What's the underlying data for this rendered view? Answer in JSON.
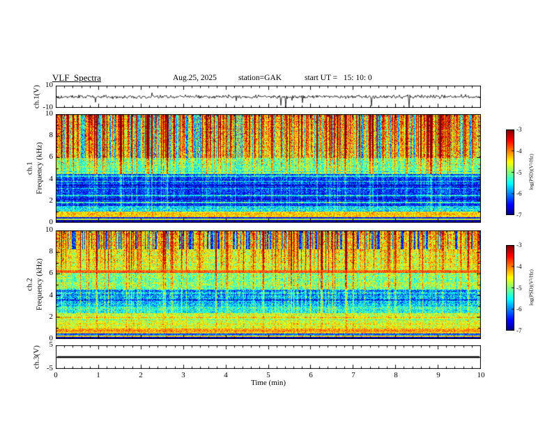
{
  "header": {
    "title": "VLF  Spectra",
    "date": "Aug.25, 2025",
    "station": "station=GAK",
    "start_ut": "start UT =   15: 10: 0"
  },
  "chart_data": {
    "type": "heatmap",
    "title": "VLF Spectra",
    "station": "GAK",
    "date": "Aug.25, 2025",
    "start_ut": "15:10:0",
    "x": {
      "label": "Time  (min)",
      "range": [
        0,
        10
      ],
      "ticks": [
        0,
        1,
        2,
        3,
        4,
        5,
        6,
        7,
        8,
        9,
        10
      ],
      "minor_step": 0.2,
      "unit": "min"
    },
    "panels": [
      {
        "id": "ch1-waveform",
        "type": "line",
        "ylabel": "ch.1(V)",
        "ylim": [
          -10,
          10
        ],
        "yticks": [
          10,
          -10
        ],
        "yminor": [
          0
        ],
        "seed": 101,
        "noise_amp": 1.6,
        "neg_spike_prob": 0.012,
        "neg_spike_range": [
          3,
          10
        ],
        "pos_spike_prob": 0.005,
        "pos_spike_range": [
          2,
          4.5
        ],
        "description": "broadband noise about 0 V with frequent impulsive spikes down to -10 V"
      },
      {
        "id": "ch1-spectrogram",
        "type": "heatmap",
        "ylabel_channel": "ch.1",
        "ylabel_axis": "Frequency (kHz)",
        "ylim": [
          0,
          10
        ],
        "yticks": [
          0,
          2,
          4,
          6,
          8,
          10
        ],
        "yminor": [
          1,
          3,
          5,
          7,
          9
        ],
        "zlim": [
          -7,
          -3
        ],
        "seed": 202,
        "stripe_strong_prob": 0.15,
        "bands": [
          {
            "f": [
              0.0,
              0.28
            ],
            "level": -6.85,
            "noise": 0.15,
            "stripe": 0
          },
          {
            "f": [
              0.28,
              0.4
            ],
            "level": -4.7,
            "noise": 0.35,
            "stripe": 0.05
          },
          {
            "f": [
              0.4,
              0.55
            ],
            "level": -6.4,
            "noise": 0.3,
            "stripe": 0.05
          },
          {
            "f": [
              0.55,
              1.05
            ],
            "level": -4.35,
            "noise": 0.45,
            "stripe": 0.15
          },
          {
            "f": [
              1.05,
              1.55
            ],
            "level": -5.6,
            "noise": 0.6,
            "stripe": 0.25
          },
          {
            "f": [
              1.55,
              4.55
            ],
            "level": -6.45,
            "noise": 0.55,
            "stripe": 0.45
          },
          {
            "f": [
              4.55,
              6.0
            ],
            "level": -5.4,
            "noise": 0.55,
            "stripe": 1.0
          },
          {
            "f": [
              6.0,
              10.01
            ],
            "level": -5.0,
            "noise": 0.6,
            "stripe": 1.4
          }
        ],
        "hlines": [
          {
            "f": 1.9,
            "w": 0.05,
            "d": 0.9
          },
          {
            "f": 2.55,
            "w": 0.05,
            "d": 0.8
          },
          {
            "f": 3.2,
            "w": 0.05,
            "d": 0.7
          },
          {
            "f": 3.85,
            "w": 0.05,
            "d": 0.8
          },
          {
            "f": 4.35,
            "w": 0.06,
            "d": 0.9
          },
          {
            "f": 2.2,
            "w": 0.05,
            "d": -0.4
          },
          {
            "f": 3.5,
            "w": 0.05,
            "d": -0.4
          }
        ],
        "red_top": {
          "fmin": 5.2,
          "gain": 1.2,
          "speckle": 0.05
        },
        "dark_patches": {
          "fmin": 6.0,
          "thresh": 0.18,
          "amount": 1.0
        },
        "description": "impulsive vertical striations above ~5 kHz reaching -3 (red), quiet -6.5 band 1.5-4.5 kHz, bright -4.3 band near 0.6-1 kHz"
      },
      {
        "id": "ch2-spectrogram",
        "type": "heatmap",
        "ylabel_channel": "ch.2",
        "ylabel_axis": "Frequency (kHz)",
        "ylim": [
          0,
          10
        ],
        "yticks": [
          0,
          2,
          4,
          6,
          8,
          10
        ],
        "yminor": [
          1,
          3,
          5,
          7,
          9
        ],
        "zlim": [
          -7,
          -3
        ],
        "seed": 303,
        "stripe_strong_prob": 0.12,
        "bands": [
          {
            "f": [
              0.0,
              0.22
            ],
            "level": -6.85,
            "noise": 0.2,
            "stripe": 0
          },
          {
            "f": [
              0.22,
              0.36
            ],
            "level": -4.5,
            "noise": 0.4,
            "stripe": 0.05
          },
          {
            "f": [
              0.36,
              0.52
            ],
            "level": -6.2,
            "noise": 0.4,
            "stripe": 0.1
          },
          {
            "f": [
              0.52,
              1.0
            ],
            "level": -4.15,
            "noise": 0.4,
            "stripe": 0.1
          },
          {
            "f": [
              1.0,
              2.4
            ],
            "level": -4.8,
            "noise": 0.5,
            "stripe": 0.3
          },
          {
            "f": [
              2.4,
              3.2
            ],
            "level": -5.5,
            "noise": 0.6,
            "stripe": 0.5
          },
          {
            "f": [
              3.2,
              4.6
            ],
            "level": -5.95,
            "noise": 0.65,
            "stripe": 0.75
          },
          {
            "f": [
              4.6,
              6.12
            ],
            "level": -5.25,
            "noise": 0.6,
            "stripe": 0.85
          },
          {
            "f": [
              6.12,
              6.38
            ],
            "level": -3.95,
            "noise": 0.3,
            "stripe": 0.15
          },
          {
            "f": [
              6.38,
              10.01
            ],
            "level": -4.9,
            "noise": 0.6,
            "stripe": 1.0
          }
        ],
        "hlines": [
          {
            "f": 3.6,
            "w": 0.06,
            "d": -0.7
          },
          {
            "f": 4.1,
            "w": 0.05,
            "d": -0.5
          },
          {
            "f": 4.5,
            "w": 0.05,
            "d": -0.5
          },
          {
            "f": 2.0,
            "w": 0.06,
            "d": 0.4
          },
          {
            "f": 1.4,
            "w": 0.05,
            "d": 0.3
          }
        ],
        "red_top": {
          "fmin": 7.0,
          "gain": 0.6,
          "speckle": 0.02
        },
        "dark_patches": {
          "fmin": 8.3,
          "thresh": 0.22,
          "amount": 1.6
        },
        "description": "greenish -4.8 background with vertical striations, bright yellow line at ~6.25 kHz, bright -4.1 band 0.5-1 kHz, dark columns near top"
      },
      {
        "id": "ch3-waveform",
        "type": "flatline",
        "ylabel": "ch.3(V)",
        "ylim": [
          -5,
          5
        ],
        "yticks": [
          5,
          -5
        ],
        "yminor": [
          0
        ],
        "value": 0,
        "linewidth": 2.5,
        "description": "constant 0 V thick trace"
      }
    ],
    "colorbars": [
      {
        "label": "log(PSD)(V²/Hz)",
        "ticks": [
          -3,
          -4,
          -5,
          -6,
          -7
        ],
        "range": [
          -7,
          -3
        ],
        "colormap": "jet"
      },
      {
        "label": "log(PSD)(V²/Hz)",
        "ticks": [
          -3,
          -4,
          -5,
          -6,
          -7
        ],
        "range": [
          -7,
          -3
        ],
        "colormap": "jet"
      }
    ]
  }
}
